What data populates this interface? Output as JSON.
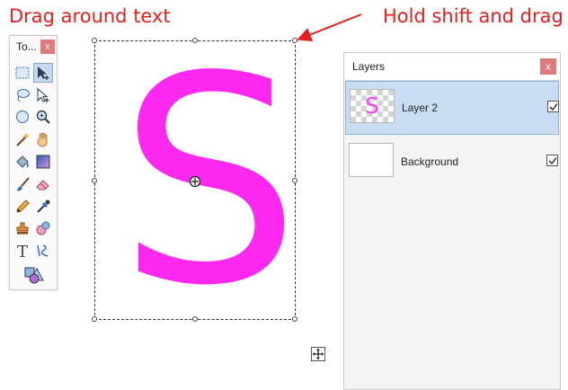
{
  "annotations": {
    "left": "Drag around text",
    "right": "Hold shift and drag"
  },
  "tools_window": {
    "title": "To...",
    "close": "x",
    "tools": [
      {
        "name": "rectangle-select-icon",
        "selected": false
      },
      {
        "name": "move-selected-pixels-icon",
        "selected": true
      },
      {
        "name": "lasso-select-icon",
        "selected": false
      },
      {
        "name": "move-selection-icon",
        "selected": false
      },
      {
        "name": "ellipse-select-icon",
        "selected": false
      },
      {
        "name": "zoom-icon",
        "selected": false
      },
      {
        "name": "magic-wand-icon",
        "selected": false
      },
      {
        "name": "pan-icon",
        "selected": false
      },
      {
        "name": "paint-bucket-icon",
        "selected": false
      },
      {
        "name": "gradient-icon",
        "selected": false
      },
      {
        "name": "paintbrush-icon",
        "selected": false
      },
      {
        "name": "eraser-icon",
        "selected": false
      },
      {
        "name": "pencil-icon",
        "selected": false
      },
      {
        "name": "color-picker-icon",
        "selected": false
      },
      {
        "name": "clone-stamp-icon",
        "selected": false
      },
      {
        "name": "recolor-icon",
        "selected": false
      },
      {
        "name": "text-icon",
        "selected": false
      },
      {
        "name": "line-curve-icon",
        "selected": false
      },
      {
        "name": "shapes-icon",
        "selected": false
      }
    ]
  },
  "canvas": {
    "letter": "S",
    "letter_color": "#ff28ee"
  },
  "layers_panel": {
    "title": "Layers",
    "close": "x",
    "layers": [
      {
        "name": "Layer 2",
        "thumb_text": "S",
        "visible": true,
        "selected": true
      },
      {
        "name": "Background",
        "thumb_text": "",
        "visible": true,
        "selected": false
      }
    ]
  },
  "colors": {
    "annotation": "#ea1c1c",
    "accent": "#ff28ee",
    "selection_bg": "#c8ddf2",
    "close_button": "#e0797a"
  }
}
